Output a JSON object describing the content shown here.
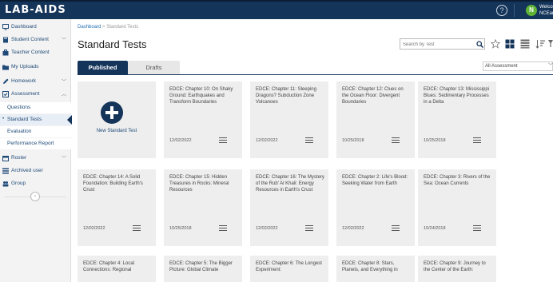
{
  "header": {
    "logo": "LAB-AIDS",
    "help_icon": "?",
    "avatar_initial": "N",
    "welcome_line1": "Welcome",
    "welcome_line2": "NCEarthRevie..."
  },
  "sidebar": {
    "items": [
      {
        "label": "Dashboard",
        "icon": "monitor-icon"
      },
      {
        "label": "Student Content",
        "icon": "book-icon",
        "chevron": "﹀"
      },
      {
        "label": "Teacher Content",
        "icon": "briefcase-icon"
      },
      {
        "label": "My Uploads",
        "icon": "folder-icon"
      },
      {
        "label": "Homework",
        "icon": "pencil-icon",
        "chevron": "﹀"
      },
      {
        "label": "Assessment",
        "icon": "checkbox-icon",
        "chevron": "︿"
      }
    ],
    "assessment_sub": [
      {
        "label": "Questions"
      },
      {
        "label": "Standard Tests",
        "active": true,
        "bullet": "•"
      },
      {
        "label": "Evaluation"
      },
      {
        "label": "Performance Report"
      }
    ],
    "items_after": [
      {
        "label": "Roster",
        "icon": "calendar-icon",
        "chevron": "﹀"
      },
      {
        "label": "Archived user",
        "icon": "list-icon"
      },
      {
        "label": "Group",
        "icon": "group-icon"
      }
    ],
    "collapse_glyph": "‹"
  },
  "breadcrumb": {
    "root": "Dashboard",
    "separator": ">",
    "current": "Standard Tests"
  },
  "page_title": "Standard Tests",
  "search": {
    "placeholder": "Search by Test"
  },
  "tabs": {
    "published": "Published",
    "drafts": "Drafts"
  },
  "filter": {
    "selected": "All Assessment",
    "chevron": "﹀"
  },
  "new_card": {
    "label": "New Standard Test"
  },
  "cards": [
    {
      "title": "EDCE: Chapter 10: On Shaky Ground: Earthquakes and Transform Boundaries",
      "date": "12/02/2022"
    },
    {
      "title": "EDCE: Chapter 11: Sleeping Dragons? Subduction Zone Volcanoes",
      "date": "12/02/2022"
    },
    {
      "title": "EDCE: Chapter 12: Clues on the Ocean Floor: Divergent Boundaries",
      "date": "10/25/2018"
    },
    {
      "title": "EDCE: Chapter 13: Mississippi Blues: Sedimentary Processes in a Delta",
      "date": "10/25/2018"
    },
    {
      "title": "EDCE: Chapter 14: A Solid Foundation: Building Earth's Crust",
      "date": "12/02/2022"
    },
    {
      "title": "EDCE: Chapter 15: Hidden Treasures in Rocks: Mineral Resources",
      "date": "10/25/2018"
    },
    {
      "title": "EDCE: Chapter 16: The Mystery of the Rub' Al Khali: Energy Resources in Earth's Crust",
      "date": "12/02/2022"
    },
    {
      "title": "EDCE: Chapter 2: Life's Blood: Seeking Water from Earth",
      "date": "12/02/2022"
    },
    {
      "title": "EDCE: Chapter 3: Rivers of the Sea: Ocean Currents",
      "date": "10/24/2018"
    },
    {
      "title": "EDCE: Chapter 4: Local Connections: Regional",
      "date": ""
    },
    {
      "title": "EDCE: Chapter 5: The Bigger Picture: Global Climate",
      "date": ""
    },
    {
      "title": "EDCE: Chapter 6: The Longest Experiment:",
      "date": ""
    },
    {
      "title": "EDCE: Chapter 8: Stars, Planets, and Everything in",
      "date": ""
    },
    {
      "title": "EDCE: Chapter 9: Journey to the Center of the Earth:",
      "date": ""
    }
  ],
  "colors": {
    "navy": "#14345a",
    "accent_green": "#5fb336",
    "link": "#1f6fb5"
  }
}
